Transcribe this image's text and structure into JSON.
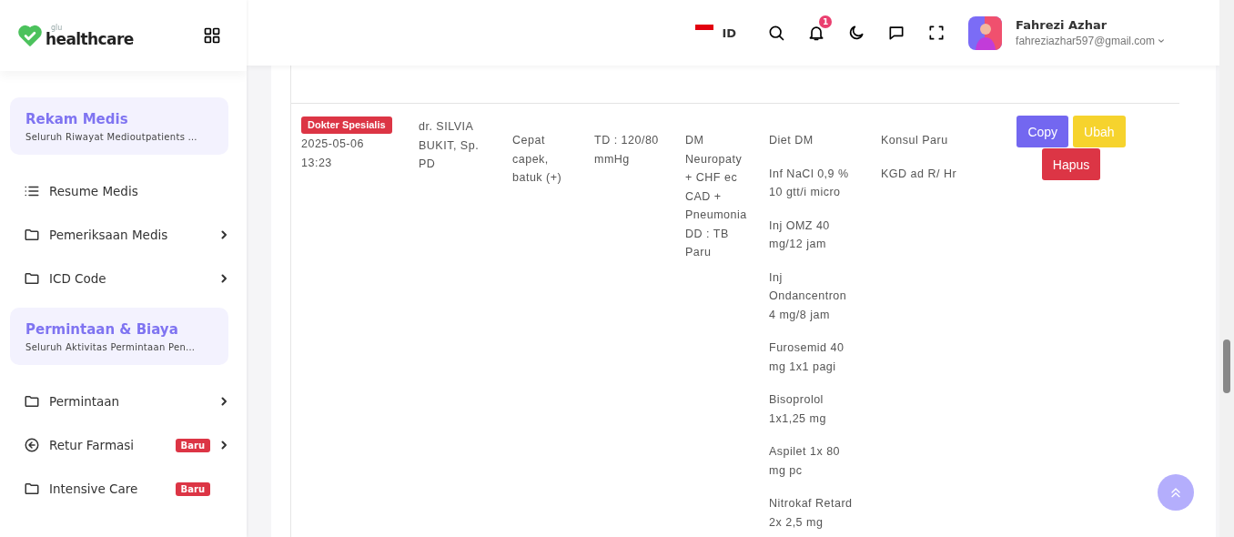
{
  "logo": {
    "small": "glu",
    "name": "healthcare"
  },
  "sidebar": {
    "sections": [
      {
        "title": "Rekam Medis",
        "subtitle": "Seluruh Riwayat Medioutpatients …",
        "items": [
          {
            "label": "Resume Medis",
            "kind": "list",
            "has_children": false
          },
          {
            "label": "Pemeriksaan Medis",
            "kind": "folder",
            "has_children": true
          },
          {
            "label": "ICD Code",
            "kind": "folder",
            "has_children": true
          }
        ]
      },
      {
        "title": "Permintaan & Biaya",
        "subtitle": "Seluruh Aktivitas Permintaan Pen…",
        "items": [
          {
            "label": "Permintaan",
            "kind": "folder",
            "has_children": true
          },
          {
            "label": "Retur Farmasi",
            "kind": "return",
            "has_children": true,
            "badge": "Baru"
          },
          {
            "label": "Intensive Care",
            "kind": "folder",
            "has_children": false,
            "badge": "Baru"
          }
        ]
      }
    ]
  },
  "header": {
    "language": "ID",
    "notification_count": "1",
    "user": {
      "name": "Fahrezi Azhar",
      "email": "fahreziazhar597@gmail.com"
    }
  },
  "table": {
    "rows": [
      {
        "type": "Dokter Spesialis",
        "date": "2025-05-06",
        "time": "13:23",
        "doctor": "dr. SILVIA BUKIT, Sp. PD",
        "complaint": "Cepat capek, batuk (+)",
        "examination": "TD : 120/80 mmHg",
        "diagnosis": "DM Neuropaty + CHF ec CAD + Pneumonia DD : TB Paru",
        "therapy": [
          "Diet DM",
          "Inf NaCl 0,9 % 10 gtt/i micro",
          "Inj OMZ 40 mg/12 jam",
          "Inj Ondancentron 4 mg/8 jam",
          "Furosemid 40 mg 1x1 pagi",
          "Bisoprolol 1x1,25 mg",
          "Aspilet 1x 80 mg pc",
          "Nitrokaf Retard 2x 2,5 mg"
        ],
        "plan": [
          "Konsul Paru",
          "KGD ad R/ Hr"
        ],
        "actions": [
          {
            "label": "Copy",
            "kind": "copy"
          },
          {
            "label": "Ubah",
            "kind": "edit"
          },
          {
            "label": "Hapus",
            "kind": "delete"
          }
        ]
      }
    ]
  }
}
